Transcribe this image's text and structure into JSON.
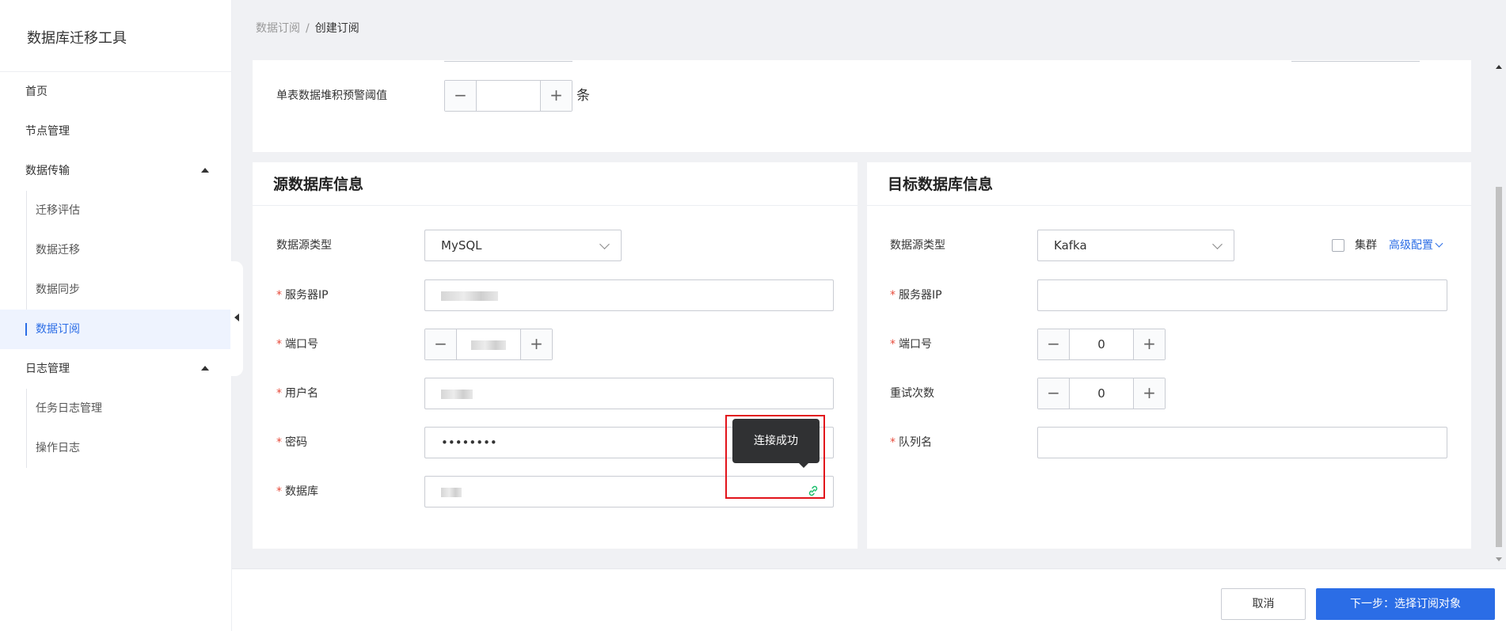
{
  "app": {
    "title": "数据库迁移工具"
  },
  "sidebar": {
    "items": [
      {
        "label": "首页"
      },
      {
        "label": "节点管理"
      },
      {
        "label": "数据传输",
        "children": [
          "迁移评估",
          "数据迁移",
          "数据同步",
          "数据订阅"
        ]
      },
      {
        "label": "日志管理",
        "children": [
          "任务日志管理",
          "操作日志"
        ]
      }
    ],
    "active": "数据订阅"
  },
  "breadcrumb": {
    "parent": "数据订阅",
    "separator": "/",
    "current": "创建订阅"
  },
  "top_section": {
    "threshold_label": "单表数据堆积预警阈值",
    "threshold_value": "",
    "threshold_unit": "条"
  },
  "source": {
    "title": "源数据库信息",
    "type_label": "数据源类型",
    "type_value": "MySQL",
    "ip_label": "服务器IP",
    "port_label": "端口号",
    "user_label": "用户名",
    "password_label": "密码",
    "password_value": "••••••••",
    "db_label": "数据库",
    "tooltip": "连接成功"
  },
  "target": {
    "title": "目标数据库信息",
    "type_label": "数据源类型",
    "type_value": "Kafka",
    "cluster_label": "集群",
    "advanced_label": "高级配置",
    "ip_label": "服务器IP",
    "ip_value": "",
    "port_label": "端口号",
    "port_value": "0",
    "retry_label": "重试次数",
    "retry_value": "0",
    "queue_label": "队列名",
    "queue_value": ""
  },
  "footer": {
    "cancel_label": "取消",
    "next_label": "下一步：选择订阅对象"
  },
  "colors": {
    "primary": "#2b6de6",
    "required": "#e74c3c",
    "highlight": "#e2141b",
    "link_success": "#19be6b"
  },
  "icons": {
    "link": "link-icon",
    "stepper_minus": "minus-icon",
    "stepper_plus": "plus-icon"
  }
}
